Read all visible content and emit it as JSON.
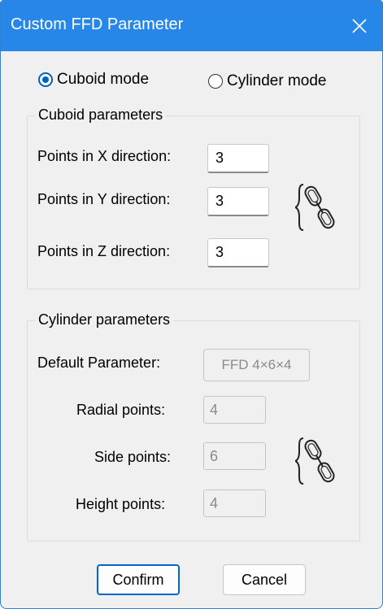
{
  "window": {
    "title": "Custom FFD Parameter"
  },
  "mode": {
    "cuboid_label": "Cuboid mode",
    "cylinder_label": "Cylinder mode",
    "selected": "cuboid"
  },
  "cuboid": {
    "group_label": "Cuboid parameters",
    "x_label": "Points in X direction:",
    "x_value": "3",
    "y_label": "Points in Y direction:",
    "y_value": "3",
    "z_label": "Points in Z direction:",
    "z_value": "3",
    "link_icon": "chain-link-icon"
  },
  "cylinder": {
    "group_label": "Cylinder parameters",
    "default_label": "Default Parameter:",
    "default_value": "FFD 4×6×4",
    "radial_label": "Radial points:",
    "radial_value": "4",
    "side_label": "Side points:",
    "side_value": "6",
    "height_label": "Height points:",
    "height_value": "4",
    "link_icon": "chain-link-icon"
  },
  "buttons": {
    "confirm": "Confirm",
    "cancel": "Cancel"
  },
  "colors": {
    "titlebar": "#2787e8",
    "accent": "#0066c8"
  }
}
